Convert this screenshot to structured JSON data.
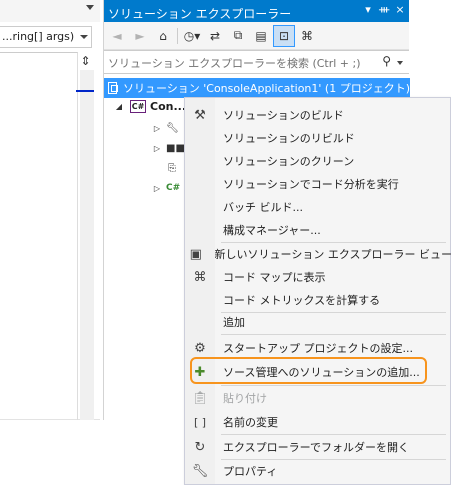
{
  "editor": {
    "signature_fragment": "...ring[] args)"
  },
  "solution_explorer": {
    "title": "ソリューション エクスプローラー",
    "title_buttons": [
      "▾",
      "ᚒ",
      "×"
    ],
    "search_placeholder": "ソリューション エクスプローラーを検索 (Ctrl + ;)",
    "tree": {
      "solution_label": "ソリューション 'ConsoleApplication1' (1 プロジェクト)",
      "project_label": "Con..."
    }
  },
  "context_menu": {
    "items": [
      {
        "label": "ソリューションのビルド",
        "icon": "build-icon"
      },
      {
        "label": "ソリューションのリビルド",
        "icon": ""
      },
      {
        "label": "ソリューションのクリーン",
        "icon": ""
      },
      {
        "label": "ソリューションでコード分析を実行",
        "icon": ""
      },
      {
        "label": "バッチ ビルド...",
        "icon": ""
      },
      {
        "label": "構成マネージャー...",
        "icon": ""
      },
      {
        "label": "新しいソリューション エクスプローラー ビュー",
        "icon": "new-view-icon"
      },
      {
        "label": "コード マップに表示",
        "icon": "code-map-icon"
      },
      {
        "label": "コード メトリックスを計算する",
        "icon": ""
      },
      {
        "label": "追加",
        "icon": ""
      },
      {
        "label": "スタートアップ プロジェクトの設定...",
        "icon": "gear-icon"
      },
      {
        "label": "ソース管理へのソリューションの追加...",
        "icon": "source-control-add-icon"
      },
      {
        "label": "貼り付け",
        "icon": "paste-icon",
        "disabled": true
      },
      {
        "label": "名前の変更",
        "icon": "rename-icon"
      },
      {
        "label": "エクスプローラーでフォルダーを開く",
        "icon": "open-folder-icon"
      },
      {
        "label": "プロパティ",
        "icon": "wrench-icon"
      }
    ]
  },
  "colors": {
    "title_bar": "#007acc",
    "selection": "#3399ff",
    "highlight_outline": "#f7941d"
  }
}
